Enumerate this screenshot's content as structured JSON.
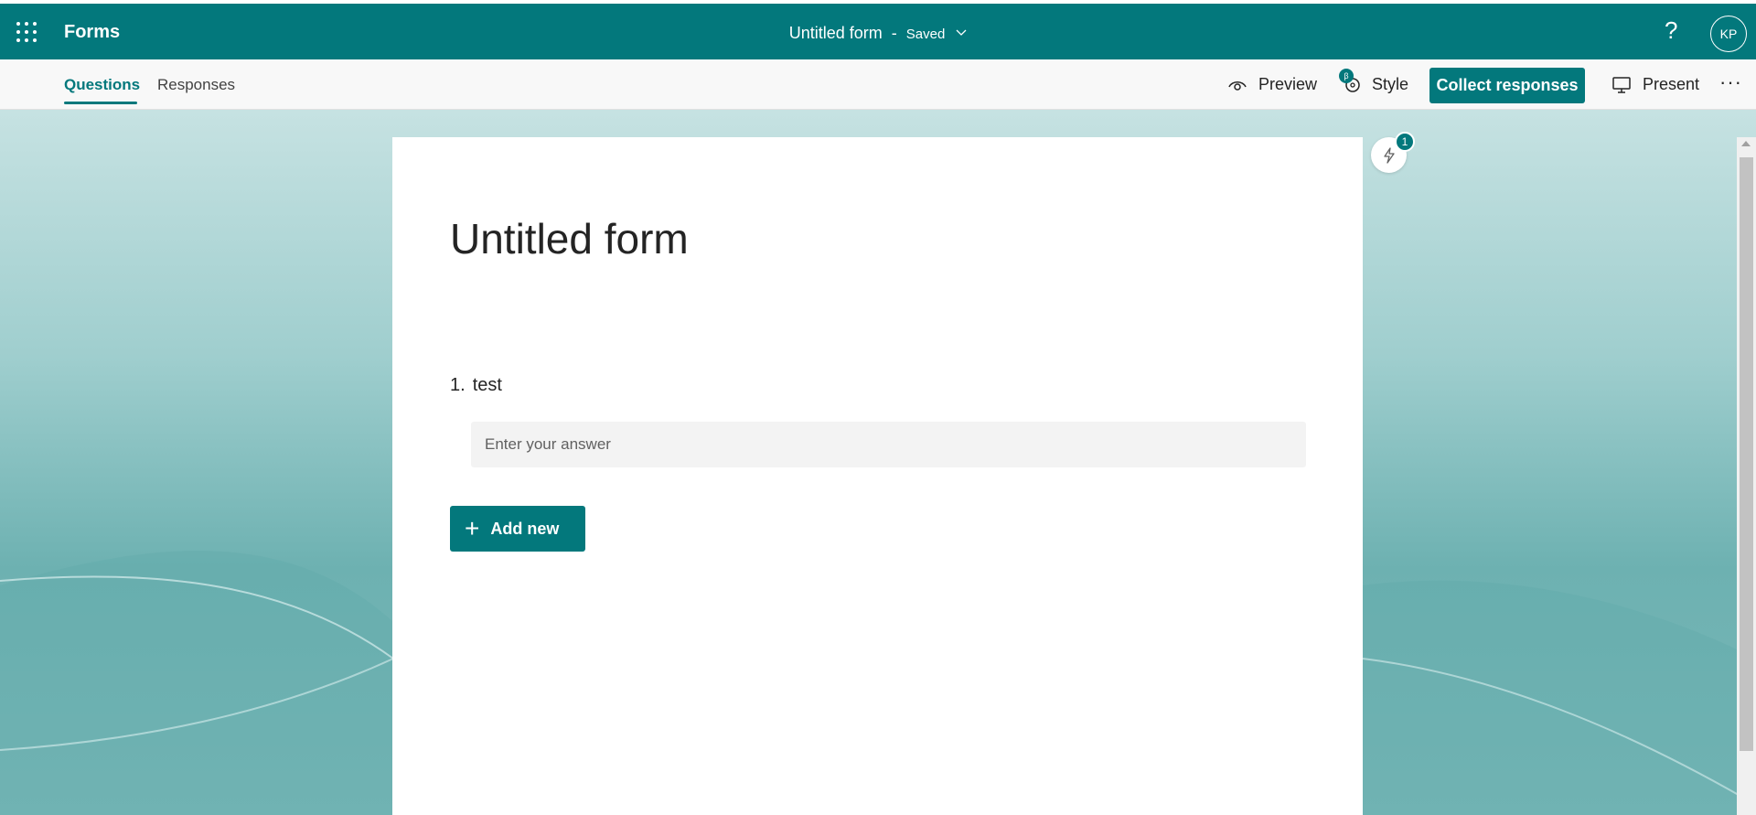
{
  "appbar": {
    "app_name": "Forms",
    "doc_title": "Untitled form",
    "separator": "-",
    "save_status": "Saved",
    "help_label": "?",
    "avatar_initials": "KP"
  },
  "tabs": [
    {
      "label": "Questions",
      "active": true
    },
    {
      "label": "Responses",
      "active": false
    }
  ],
  "commands": {
    "preview_label": "Preview",
    "style_label": "Style",
    "style_badge": "β",
    "collect_label": "Collect responses",
    "present_label": "Present",
    "more_label": "···"
  },
  "form": {
    "title": "Untitled form",
    "questions": [
      {
        "number": "1.",
        "text": "test",
        "placeholder": "Enter your answer"
      }
    ],
    "add_new_label": "Add new"
  },
  "insights": {
    "badge_count": "1"
  },
  "colors": {
    "brand": "#03787c",
    "command_bar": "#f8f8f8",
    "input_bg": "#f3f3f3"
  },
  "icons": [
    "app-launcher-icon",
    "chevron-down-icon",
    "eye-icon",
    "palette-icon",
    "monitor-icon",
    "plus-icon",
    "lightning-icon"
  ]
}
